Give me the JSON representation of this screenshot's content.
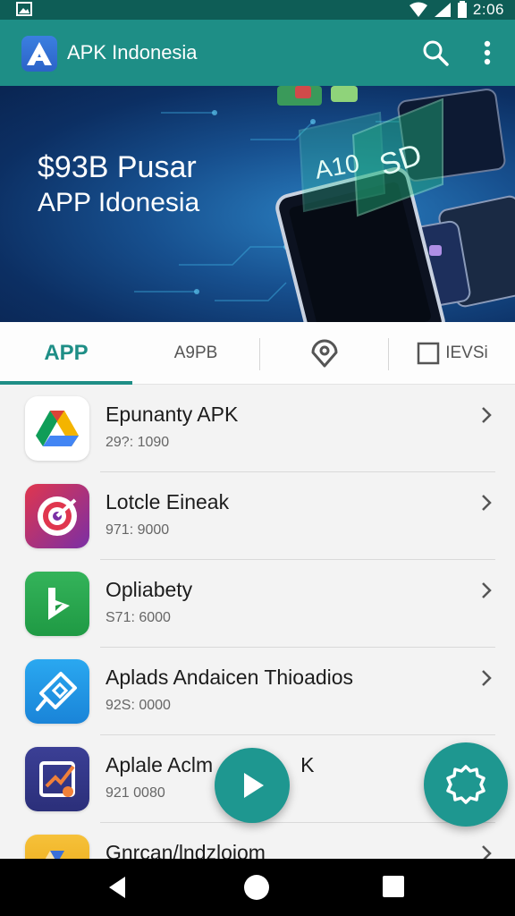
{
  "status_bar": {
    "time": "2:06"
  },
  "app_bar": {
    "title": "APK Indonesia",
    "logo_letter": "A"
  },
  "banner": {
    "title": "$93B Pusar",
    "subtitle": "APP Idonesia",
    "screen_text_1": "A10",
    "screen_text_2": "SD"
  },
  "tabs": [
    {
      "label": "APP",
      "active": true
    },
    {
      "label": "A9PB",
      "active": false
    },
    {
      "label": "",
      "active": false,
      "icon": "map-pin-icon"
    },
    {
      "label": "IEVSi",
      "active": false,
      "icon": "square-icon"
    }
  ],
  "apps": [
    {
      "name": "Epunanty APK",
      "meta": "29?: 1090",
      "icon": "google-drive-icon",
      "color": "#ffffff"
    },
    {
      "name": "Lotcle Eineak",
      "meta": "971: 9000",
      "icon": "target-icon",
      "color": "#e0364e"
    },
    {
      "name": "Opliabety",
      "meta": "S71: 6000",
      "icon": "play-flag-icon",
      "color": "#2eaa4c"
    },
    {
      "name": "Aplads Andaicen Thioadios",
      "meta": "92S: 0000",
      "icon": "diamond-app-icon",
      "color": "#1f9be6"
    },
    {
      "name": "Aplale Aclm",
      "name_tail": "K",
      "meta": "921 0080",
      "icon": "chart-edit-icon",
      "color": "#3a3f8f"
    },
    {
      "name": "Gnrcan/lndzloiom",
      "meta": "",
      "icon": "drive-partial-icon",
      "color": "#f4b400"
    }
  ],
  "colors": {
    "primary": "#1e8e86",
    "fab": "#1e9790"
  }
}
